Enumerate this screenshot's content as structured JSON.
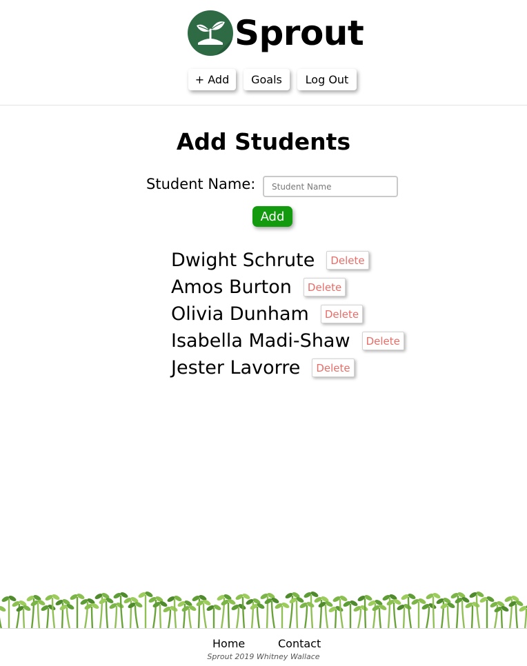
{
  "brand": {
    "name": "Sprout",
    "logo_color": "#2e6b45"
  },
  "nav": {
    "add_label": "+ Add",
    "goals_label": "Goals",
    "logout_label": "Log Out"
  },
  "main": {
    "title": "Add Students",
    "form": {
      "label": "Student Name:",
      "placeholder": "Student Name",
      "value": "",
      "add_label": "Add",
      "add_color": "#139a0e"
    },
    "students": [
      {
        "name": "Dwight Schrute",
        "delete_label": "Delete"
      },
      {
        "name": "Amos Burton",
        "delete_label": "Delete"
      },
      {
        "name": "Olivia Dunham",
        "delete_label": "Delete"
      },
      {
        "name": "Isabella Madi-Shaw",
        "delete_label": "Delete"
      },
      {
        "name": "Jester Lavorre",
        "delete_label": "Delete"
      }
    ],
    "delete_color": "#ea6c67"
  },
  "footer": {
    "home_label": "Home",
    "contact_label": "Contact",
    "copyright": "Sprout 2019 Whitney Wallace",
    "decoration": "sprouts-border"
  }
}
